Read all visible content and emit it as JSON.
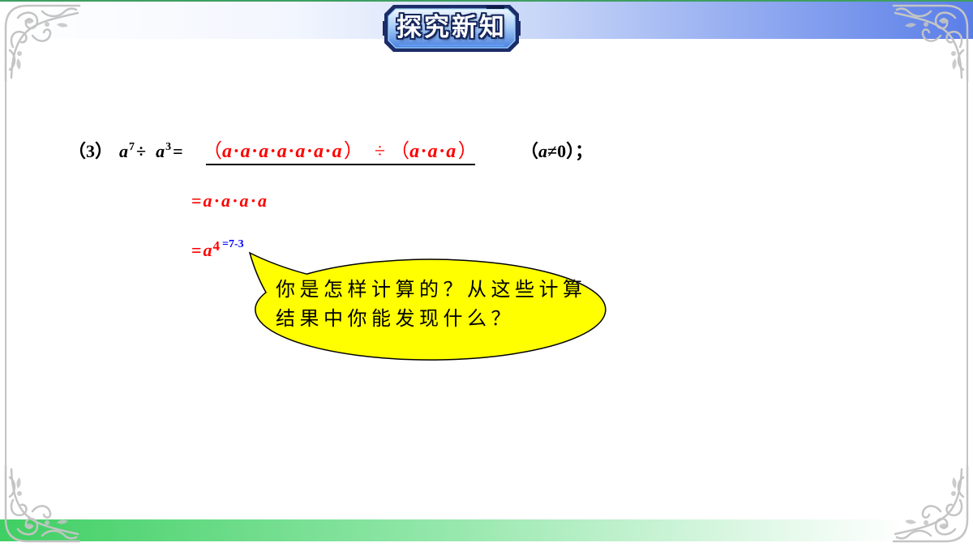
{
  "slide": {
    "title": "探究新知",
    "problem": {
      "number": "（3）",
      "base1": "a",
      "exp1": "7",
      "div": "÷",
      "base2": "a",
      "exp2": "3",
      "eq": "=",
      "answer": {
        "open1": "（",
        "left": "a·a·a·a·a·a·a",
        "close1": "）",
        "op": "÷",
        "open2": "（",
        "right": "a·a·a",
        "close2": "）"
      },
      "condition": {
        "open": "（",
        "var": "a",
        "rest": "≠0）；"
      }
    },
    "steps": [
      {
        "eq": "=",
        "expr": "a·a·a·a"
      },
      {
        "eq": "=",
        "base": "a",
        "exp": "4",
        "note": "=7-3"
      }
    ],
    "bubble": {
      "lines": [
        "你是怎样计算的？从这些计算",
        "结果中你能发现什么？"
      ]
    }
  },
  "decorations": {
    "corner_ornament": "scroll-ornament-icon",
    "speech_bubble": "speech-bubble-icon"
  },
  "colors": {
    "answer": "#ff0000",
    "note": "#0000ff",
    "bubble_fill": "#ffff00",
    "top_band": "#5a7ee8",
    "bottom_band": "#3fcf63",
    "ornament": "#c4c4c4",
    "text": "#000000"
  }
}
